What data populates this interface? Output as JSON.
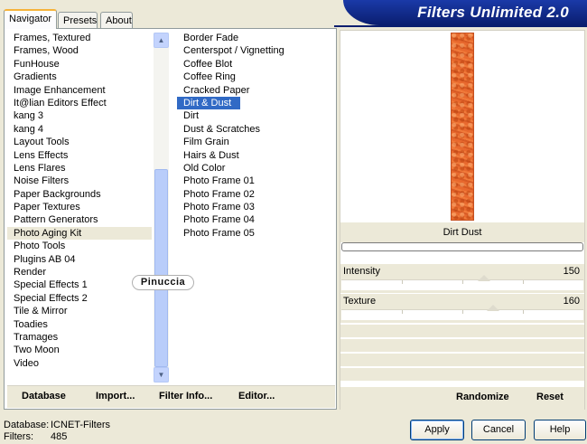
{
  "tabs": [
    {
      "label": "Navigator",
      "active": true
    },
    {
      "label": "Presets",
      "active": false
    },
    {
      "label": "About",
      "active": false
    }
  ],
  "banner": {
    "title": "Filters Unlimited 2.0"
  },
  "categories": {
    "items": [
      "Frames, Textured",
      "Frames, Wood",
      "FunHouse",
      "Gradients",
      "Image Enhancement",
      "It@lian Editors Effect",
      "kang 3",
      "kang 4",
      "Layout Tools",
      "Lens Effects",
      "Lens Flares",
      "Noise Filters",
      "Paper Backgrounds",
      "Paper Textures",
      "Pattern Generators",
      "Photo Aging Kit",
      "Photo Tools",
      "Plugins AB 04",
      "Render",
      "Special Effects 1",
      "Special Effects 2",
      "Tile & Mirror",
      "Toadies",
      "Tramages",
      "Two Moon",
      "Video"
    ],
    "selected_index": 15
  },
  "filters": {
    "items": [
      "Border Fade",
      "Centerspot / Vignetting",
      "Coffee Blot",
      "Coffee Ring",
      "Cracked Paper",
      "Dirt & Dust",
      "Dirt",
      "Dust & Scratches",
      "Film Grain",
      "Hairs & Dust",
      "Old Color",
      "Photo Frame 01",
      "Photo Frame 02",
      "Photo Frame 03",
      "Photo Frame 04",
      "Photo Frame 05"
    ],
    "selected_index": 5
  },
  "toolbar": {
    "database": "Database",
    "import": "Import...",
    "filter_info": "Filter Info...",
    "editor": "Editor..."
  },
  "preview": {
    "filter_name": "Dirt  Dust"
  },
  "params": [
    {
      "label": "Intensity",
      "value": "150",
      "fraction": 0.588
    },
    {
      "label": "Texture",
      "value": "160",
      "fraction": 0.627
    }
  ],
  "right_buttons": {
    "randomize": "Randomize",
    "reset": "Reset"
  },
  "watermark": "Pinuccia",
  "status": {
    "database_label": "Database:",
    "database_value": "ICNET-Filters",
    "filters_label": "Filters:",
    "filters_value": "485"
  },
  "dialog": {
    "apply": "Apply",
    "cancel": "Cancel",
    "help": "Help"
  },
  "colors": {
    "selection": "#316ac5",
    "banner": "#0a1e6e",
    "preview": "#e8692e"
  }
}
